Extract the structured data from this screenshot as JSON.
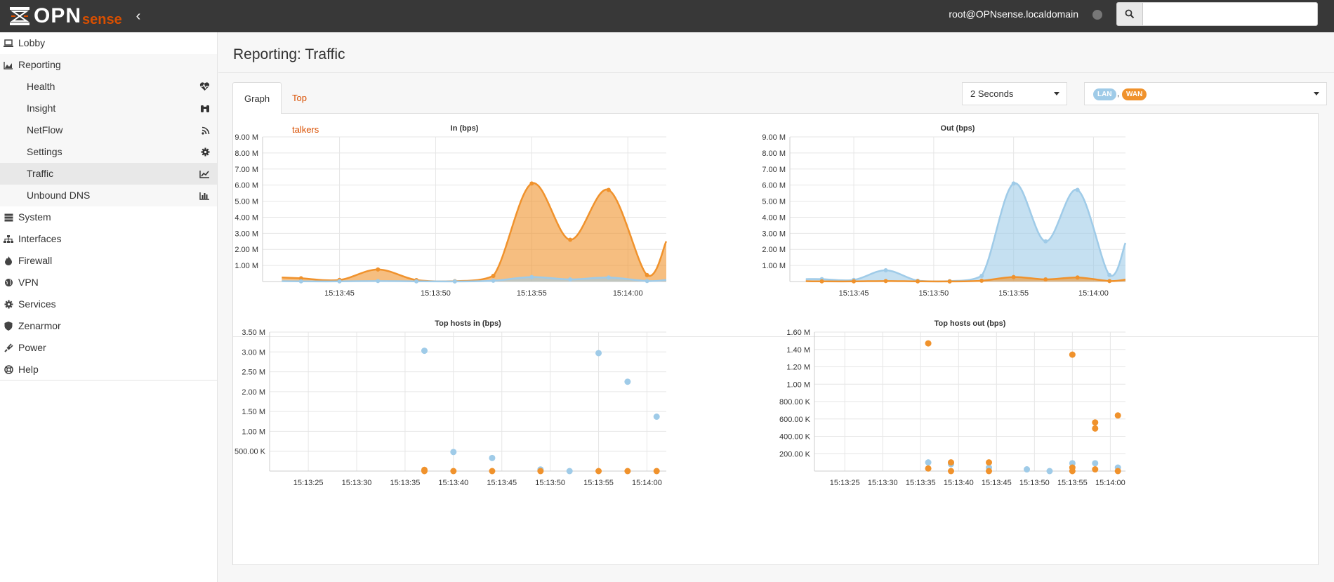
{
  "header": {
    "logo_main": "OPN",
    "logo_sub": "sense",
    "user": "root@OPNsense.localdomain",
    "search": {
      "placeholder": "",
      "value": ""
    }
  },
  "sidebar": {
    "items": [
      {
        "label": "Lobby",
        "icon": "laptop-icon"
      },
      {
        "label": "Reporting",
        "icon": "area-chart-icon"
      },
      {
        "label": "System",
        "icon": "server-icon"
      },
      {
        "label": "Interfaces",
        "icon": "sitemap-icon"
      },
      {
        "label": "Firewall",
        "icon": "fire-icon"
      },
      {
        "label": "VPN",
        "icon": "globe-icon"
      },
      {
        "label": "Services",
        "icon": "cog-icon"
      },
      {
        "label": "Zenarmor",
        "icon": "shield-icon"
      },
      {
        "label": "Power",
        "icon": "plug-icon"
      },
      {
        "label": "Help",
        "icon": "life-ring-icon"
      }
    ],
    "reporting_sub": [
      {
        "label": "Health",
        "icon": "heartbeat-icon"
      },
      {
        "label": "Insight",
        "icon": "binoculars-icon"
      },
      {
        "label": "NetFlow",
        "icon": "rss-icon"
      },
      {
        "label": "Settings",
        "icon": "cog-icon"
      },
      {
        "label": "Traffic",
        "icon": "line-chart-icon",
        "active": true
      },
      {
        "label": "Unbound DNS",
        "icon": "bar-chart-icon"
      }
    ]
  },
  "page": {
    "title": "Reporting: Traffic",
    "tabs": [
      "Graph",
      "Top talkers"
    ],
    "interval": "2 Seconds",
    "interfaces": [
      "LAN",
      "WAN"
    ],
    "interfaces_sep": ","
  },
  "colors": {
    "lan": "#9fcbe8",
    "wan": "#f0922c",
    "accent": "#d94f00"
  },
  "chart_data": [
    {
      "type": "area",
      "title": "In (bps)",
      "x": [
        "15:13:42",
        "15:13:43",
        "15:13:45",
        "15:13:47",
        "15:13:49",
        "15:13:51",
        "15:13:53",
        "15:13:55",
        "15:13:57",
        "15:13:59",
        "15:14:01",
        "15:14:02"
      ],
      "xticks": [
        "15:13:45",
        "15:13:50",
        "15:13:55",
        "15:14:00"
      ],
      "yticks": [
        "1.00 M",
        "2.00 M",
        "3.00 M",
        "4.00 M",
        "5.00 M",
        "6.00 M",
        "7.00 M",
        "8.00 M",
        "9.00 M"
      ],
      "ylim": [
        0,
        9000000
      ],
      "series": [
        {
          "name": "WAN",
          "values": [
            250000,
            200000,
            100000,
            750000,
            90000,
            20000,
            350000,
            6100000,
            2600000,
            5700000,
            400000,
            2500000
          ]
        },
        {
          "name": "LAN",
          "values": [
            20000,
            10000,
            10000,
            30000,
            10000,
            5000,
            50000,
            280000,
            130000,
            250000,
            30000,
            100000
          ]
        }
      ]
    },
    {
      "type": "area",
      "title": "Out (bps)",
      "x": [
        "15:13:42",
        "15:13:43",
        "15:13:45",
        "15:13:47",
        "15:13:49",
        "15:13:51",
        "15:13:53",
        "15:13:55",
        "15:13:57",
        "15:13:59",
        "15:14:01",
        "15:14:02"
      ],
      "xticks": [
        "15:13:45",
        "15:13:50",
        "15:13:55",
        "15:14:00"
      ],
      "yticks": [
        "1.00 M",
        "2.00 M",
        "3.00 M",
        "4.00 M",
        "5.00 M",
        "6.00 M",
        "7.00 M",
        "8.00 M",
        "9.00 M"
      ],
      "ylim": [
        0,
        9000000
      ],
      "series": [
        {
          "name": "LAN",
          "values": [
            150000,
            150000,
            100000,
            700000,
            50000,
            20000,
            350000,
            6100000,
            2500000,
            5700000,
            400000,
            2400000
          ]
        },
        {
          "name": "WAN",
          "values": [
            20000,
            10000,
            10000,
            30000,
            10000,
            5000,
            50000,
            280000,
            130000,
            250000,
            30000,
            120000
          ]
        }
      ]
    },
    {
      "type": "scatter",
      "title": "Top hosts in (bps)",
      "xticks": [
        "15:13:25",
        "15:13:30",
        "15:13:35",
        "15:13:40",
        "15:13:45",
        "15:13:50",
        "15:13:55",
        "15:14:00"
      ],
      "yticks": [
        "500.00 K",
        "1.00 M",
        "1.50 M",
        "2.00 M",
        "2.50 M",
        "3.00 M",
        "3.50 M"
      ],
      "xlim": [
        "15:13:21",
        "15:14:02"
      ],
      "ylim": [
        0,
        3500000
      ],
      "series": [
        {
          "name": "LAN",
          "points": [
            [
              "15:13:37",
              3030000
            ],
            [
              "15:13:40",
              480000
            ],
            [
              "15:13:44",
              330000
            ],
            [
              "15:13:49",
              40000
            ],
            [
              "15:13:52",
              0
            ],
            [
              "15:13:55",
              2970000
            ],
            [
              "15:13:58",
              2250000
            ],
            [
              "15:14:01",
              1370000
            ]
          ]
        },
        {
          "name": "WAN",
          "points": [
            [
              "15:13:37",
              30000
            ],
            [
              "15:13:37",
              0
            ],
            [
              "15:13:40",
              0
            ],
            [
              "15:13:44",
              0
            ],
            [
              "15:13:49",
              0
            ],
            [
              "15:13:55",
              0
            ],
            [
              "15:13:58",
              0
            ],
            [
              "15:14:01",
              0
            ]
          ]
        }
      ]
    },
    {
      "type": "scatter",
      "title": "Top hosts out (bps)",
      "xticks": [
        "15:13:25",
        "15:13:30",
        "15:13:35",
        "15:13:40",
        "15:13:45",
        "15:13:50",
        "15:13:55",
        "15:14:00"
      ],
      "yticks": [
        "200.00 K",
        "400.00 K",
        "600.00 K",
        "800.00 K",
        "1.00 M",
        "1.20 M",
        "1.40 M",
        "1.60 M"
      ],
      "xlim": [
        "15:13:21",
        "15:14:02"
      ],
      "ylim": [
        0,
        1600000
      ],
      "series": [
        {
          "name": "LAN",
          "points": [
            [
              "15:13:36",
              100000
            ],
            [
              "15:13:39",
              80000
            ],
            [
              "15:13:44",
              40000
            ],
            [
              "15:13:49",
              20000
            ],
            [
              "15:13:52",
              0
            ],
            [
              "15:13:55",
              90000
            ],
            [
              "15:13:58",
              90000
            ],
            [
              "15:14:01",
              40000
            ]
          ]
        },
        {
          "name": "WAN",
          "points": [
            [
              "15:13:36",
              1470000
            ],
            [
              "15:13:36",
              30000
            ],
            [
              "15:13:39",
              100000
            ],
            [
              "15:13:39",
              0
            ],
            [
              "15:13:44",
              100000
            ],
            [
              "15:13:44",
              0
            ],
            [
              "15:13:55",
              1340000
            ],
            [
              "15:13:55",
              40000
            ],
            [
              "15:13:55",
              0
            ],
            [
              "15:13:58",
              560000
            ],
            [
              "15:13:58",
              490000
            ],
            [
              "15:13:58",
              20000
            ],
            [
              "15:14:01",
              640000
            ],
            [
              "15:14:01",
              0
            ]
          ]
        }
      ]
    }
  ]
}
